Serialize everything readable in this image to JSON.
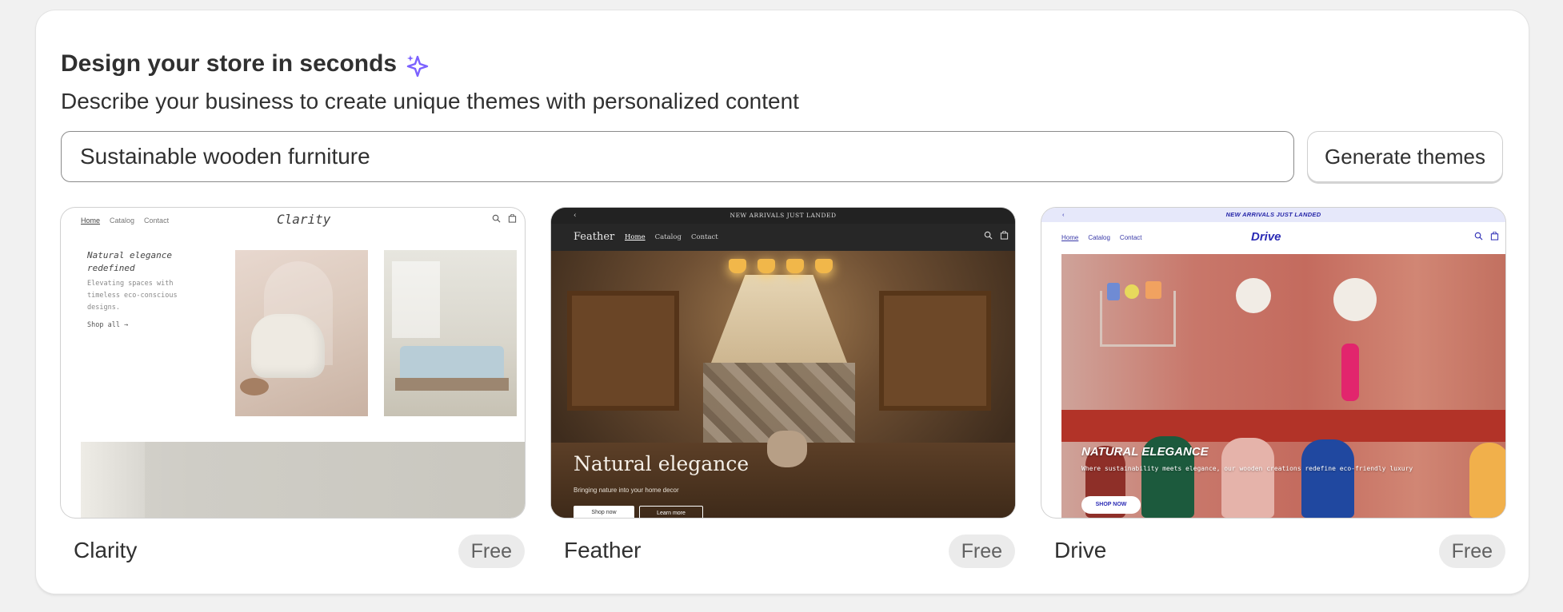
{
  "header": {
    "title": "Design your store in seconds",
    "sparkle_icon": "sparkle-icon",
    "subtitle": "Describe your business to create unique themes with personalized content"
  },
  "prompt": {
    "value": "Sustainable wooden furniture",
    "button_label": "Generate themes"
  },
  "colors": {
    "sparkle": "#7b61ff",
    "card_bg": "#ffffff",
    "page_bg": "#f1f1f1"
  },
  "themes": [
    {
      "name": "Clarity",
      "badge": "Free",
      "preview": {
        "nav": [
          "Home",
          "Catalog",
          "Contact"
        ],
        "logo": "Clarity",
        "hero_title": "Natural elegance redefined",
        "hero_subtitle": "Elevating spaces with timeless eco-conscious designs.",
        "cta": "Shop all →"
      }
    },
    {
      "name": "Feather",
      "badge": "Free",
      "preview": {
        "announcement": "NEW ARRIVALS JUST LANDED",
        "logo": "Feather",
        "nav": [
          "Home",
          "Catalog",
          "Contact"
        ],
        "hero_title": "Natural elegance",
        "hero_subtitle": "Bringing nature into your home decor",
        "cta_primary": "Shop now",
        "cta_secondary": "Learn more"
      }
    },
    {
      "name": "Drive",
      "badge": "Free",
      "preview": {
        "announcement": "NEW ARRIVALS JUST LANDED",
        "nav": [
          "Home",
          "Catalog",
          "Contact"
        ],
        "logo": "Drive",
        "hero_title": "NATURAL ELEGANCE",
        "hero_subtitle": "Where sustainability meets elegance, our wooden creations redefine eco-friendly luxury",
        "cta": "SHOP NOW"
      }
    }
  ]
}
